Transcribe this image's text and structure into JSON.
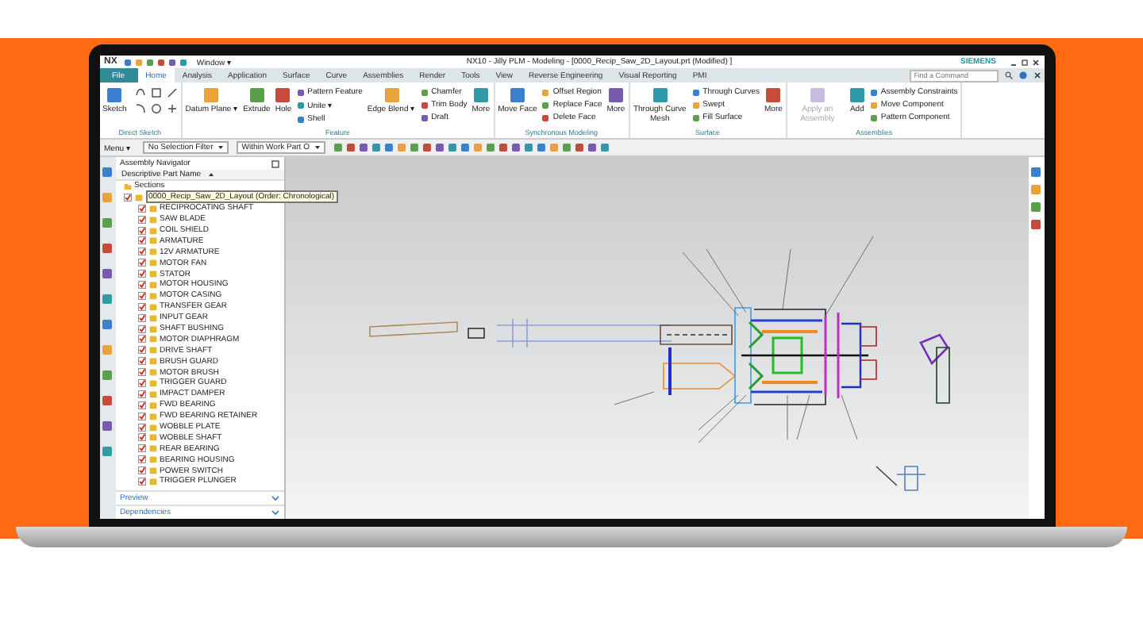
{
  "window": {
    "app_logo": "NX",
    "menu": "Window ▾",
    "title": "NX10 - Jilly PLM - Modeling - [0000_Recip_Saw_2D_Layout.prt (Modified) ]",
    "brand": "SIEMENS"
  },
  "ribbon_tabs": [
    {
      "label": "File",
      "kind": "file",
      "selected": false
    },
    {
      "label": "Home",
      "kind": "tab",
      "selected": true
    },
    {
      "label": "Analysis",
      "kind": "tab",
      "selected": false
    },
    {
      "label": "Application",
      "kind": "tab",
      "selected": false
    },
    {
      "label": "Surface",
      "kind": "tab",
      "selected": false
    },
    {
      "label": "Curve",
      "kind": "tab",
      "selected": false
    },
    {
      "label": "Assemblies",
      "kind": "tab",
      "selected": false
    },
    {
      "label": "Render",
      "kind": "tab",
      "selected": false
    },
    {
      "label": "Tools",
      "kind": "tab",
      "selected": false
    },
    {
      "label": "View",
      "kind": "tab",
      "selected": false
    },
    {
      "label": "Reverse Engineering",
      "kind": "tab",
      "selected": false
    },
    {
      "label": "Visual Reporting",
      "kind": "tab",
      "selected": false
    },
    {
      "label": "PMI",
      "kind": "tab",
      "selected": false
    }
  ],
  "command_search": {
    "placeholder": "Find a Command"
  },
  "ribbon_groups": [
    {
      "title": "Direct Sketch",
      "items": [
        {
          "label": "Sketch",
          "kind": "large",
          "disabled": false
        },
        {
          "kind": "icon_grid"
        }
      ]
    },
    {
      "title": "Feature",
      "items": [
        {
          "label": "Datum Plane ▾",
          "kind": "large",
          "disabled": false
        },
        {
          "label": "Extrude",
          "kind": "large",
          "disabled": false
        },
        {
          "label": "Hole",
          "kind": "large",
          "disabled": false
        },
        {
          "label": "Pattern Feature",
          "kind": "small",
          "disabled": false
        },
        {
          "label": "Unite ▾",
          "kind": "small",
          "disabled": false
        },
        {
          "label": "Shell",
          "kind": "small",
          "disabled": false
        },
        {
          "label": "Edge Blend ▾",
          "kind": "large",
          "disabled": false
        },
        {
          "label": "Chamfer",
          "kind": "small",
          "disabled": false
        },
        {
          "label": "Trim Body",
          "kind": "small",
          "disabled": false
        },
        {
          "label": "Draft",
          "kind": "small",
          "disabled": false
        },
        {
          "label": "More",
          "kind": "large",
          "disabled": false
        }
      ]
    },
    {
      "title": "Synchronous Modeling",
      "items": [
        {
          "label": "Move Face",
          "kind": "large",
          "disabled": false
        },
        {
          "label": "Offset Region",
          "kind": "small",
          "disabled": false
        },
        {
          "label": "Replace Face",
          "kind": "small",
          "disabled": false
        },
        {
          "label": "Delete Face",
          "kind": "small",
          "disabled": false
        },
        {
          "label": "More",
          "kind": "large",
          "disabled": false
        }
      ]
    },
    {
      "title": "Surface",
      "items": [
        {
          "label": "Through Curve Mesh",
          "kind": "large",
          "disabled": false
        },
        {
          "label": "Through Curves",
          "kind": "small",
          "disabled": false
        },
        {
          "label": "Swept",
          "kind": "small",
          "disabled": false
        },
        {
          "label": "Fill Surface",
          "kind": "small",
          "disabled": false
        },
        {
          "label": "More",
          "kind": "large",
          "disabled": false
        }
      ]
    },
    {
      "title": "Assemblies",
      "items": [
        {
          "label": "Apply an Assembly",
          "kind": "large",
          "disabled": true
        },
        {
          "label": "Add",
          "kind": "large",
          "disabled": false
        },
        {
          "label": "Assembly Constraints",
          "kind": "small",
          "disabled": false
        },
        {
          "label": "Move Component",
          "kind": "small",
          "disabled": false
        },
        {
          "label": "Pattern Component",
          "kind": "small",
          "disabled": false
        }
      ]
    }
  ],
  "toolbar": {
    "menu": "Menu ▾",
    "filters": [
      "No Selection Filter",
      "Within Work Part O"
    ]
  },
  "navigator": {
    "title": "Assembly Navigator",
    "column": "Descriptive Part Name",
    "sections": "Sections",
    "root": {
      "label": "0000_Recip_Saw_2D_Layout (Order: Chronological)",
      "checked": true,
      "selected": true,
      "children": [
        {
          "label": "RECIPROCATING SHAFT",
          "checked": true
        },
        {
          "label": "SAW BLADE",
          "checked": true
        },
        {
          "label": "COIL SHIELD",
          "checked": true
        },
        {
          "label": "ARMATURE",
          "checked": true
        },
        {
          "label": "12V ARMATURE",
          "checked": true
        },
        {
          "label": "MOTOR FAN",
          "checked": true
        },
        {
          "label": "STATOR",
          "checked": true
        },
        {
          "label": "MOTOR HOUSING",
          "checked": true
        },
        {
          "label": "MOTOR CASING",
          "checked": true
        },
        {
          "label": "TRANSFER GEAR",
          "checked": true
        },
        {
          "label": "INPUT GEAR",
          "checked": true
        },
        {
          "label": "SHAFT BUSHING",
          "checked": true
        },
        {
          "label": "MOTOR DIAPHRAGM",
          "checked": true
        },
        {
          "label": "DRIVE SHAFT",
          "checked": true
        },
        {
          "label": "BRUSH GUARD",
          "checked": true
        },
        {
          "label": "MOTOR BRUSH",
          "checked": true
        },
        {
          "label": "TRIGGER GUARD",
          "checked": true
        },
        {
          "label": "IMPACT DAMPER",
          "checked": true
        },
        {
          "label": "FWD BEARING",
          "checked": true
        },
        {
          "label": "FWD BEARING RETAINER",
          "checked": true
        },
        {
          "label": "WOBBLE PLATE",
          "checked": true
        },
        {
          "label": "WOBBLE SHAFT",
          "checked": true
        },
        {
          "label": "REAR BEARING",
          "checked": true
        },
        {
          "label": "BEARING HOUSING",
          "checked": true
        },
        {
          "label": "POWER SWITCH",
          "checked": true
        },
        {
          "label": "TRIGGER PLUNGER",
          "checked": true
        }
      ]
    },
    "panels": [
      "Preview",
      "Dependencies"
    ]
  }
}
